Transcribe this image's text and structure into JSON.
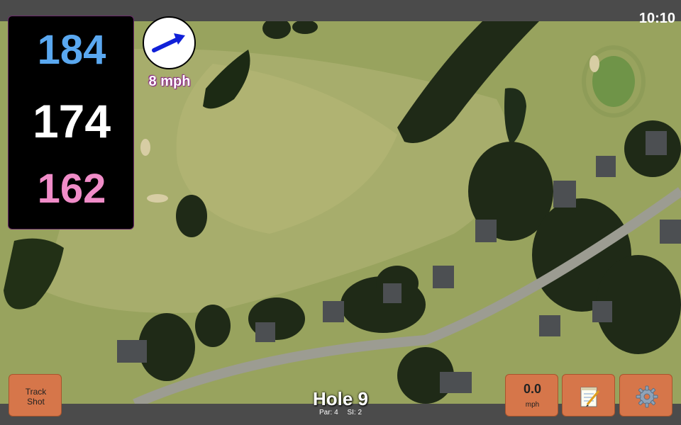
{
  "status_bar": {
    "time": "10:10"
  },
  "yardages": {
    "back": "184",
    "center": "174",
    "front": "162"
  },
  "wind": {
    "speed_label": "8 mph",
    "direction": "northeast"
  },
  "buttons": {
    "track_shot": {
      "line1": "Track",
      "line2": "Shot"
    },
    "speed": {
      "value": "0.0",
      "unit": "mph"
    },
    "notes": {
      "icon": "notepad-icon"
    },
    "settings": {
      "icon": "gear-icon"
    }
  },
  "hole": {
    "title": "Hole 9",
    "par": "Par: 4",
    "si": "SI: 2"
  },
  "colors": {
    "back_yardage": "#5aa8f0",
    "center_yardage": "#ffffff",
    "front_yardage": "#f08cc8",
    "button": "#d6764a",
    "wind_arrow": "#1020d8"
  }
}
